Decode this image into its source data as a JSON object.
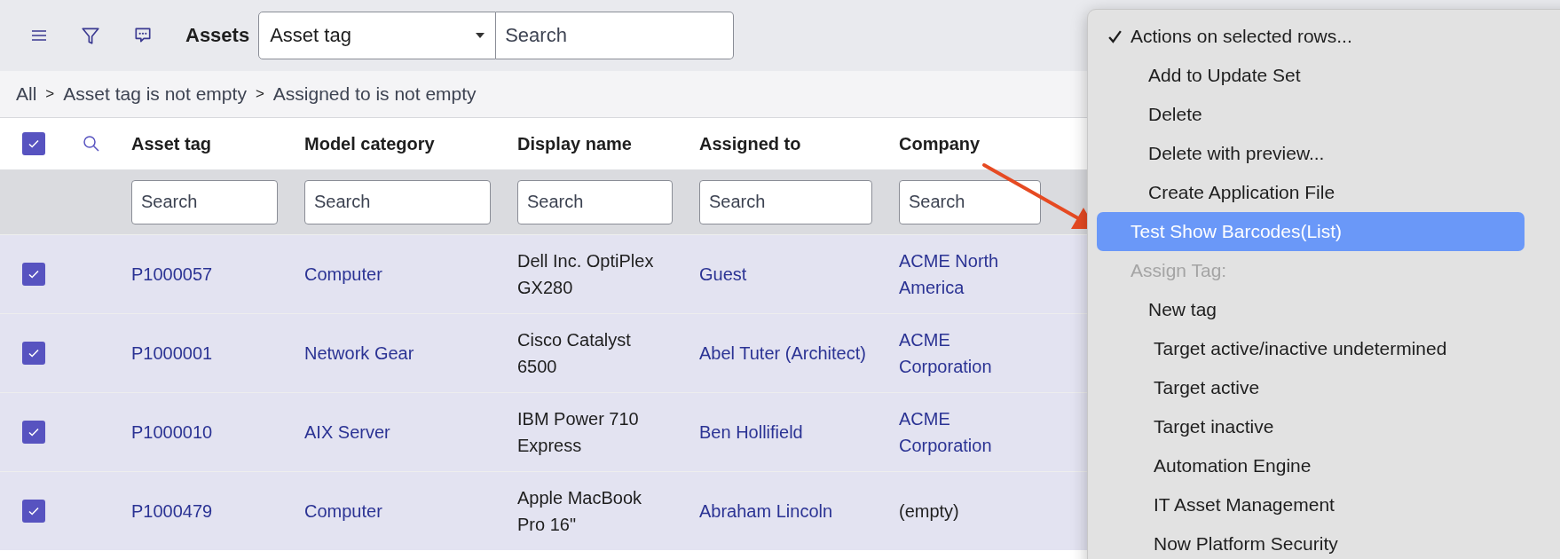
{
  "toolbar": {
    "title": "Assets",
    "field_select": "Asset tag",
    "search": {
      "placeholder": "Search"
    }
  },
  "breadcrumb": {
    "separator": ">",
    "items": [
      "All",
      "Asset tag is not empty",
      "Assigned to is not empty"
    ]
  },
  "table": {
    "select_all": {
      "checked": true
    },
    "columns": [
      {
        "label": "Asset tag",
        "placeholder": "Search"
      },
      {
        "label": "Model category",
        "placeholder": "Search"
      },
      {
        "label": "Display name",
        "placeholder": "Search"
      },
      {
        "label": "Assigned to",
        "placeholder": "Search"
      },
      {
        "label": "Company",
        "placeholder": "Search"
      }
    ],
    "rows": [
      {
        "selected": true,
        "asset_tag": "P1000057",
        "model_category": "Computer",
        "display_name": "Dell Inc. OptiPlex GX280",
        "assigned_to": "Guest",
        "company": {
          "text": "ACME North America",
          "kind": "link"
        }
      },
      {
        "selected": true,
        "asset_tag": "P1000001",
        "model_category": "Network Gear",
        "display_name": "Cisco Catalyst 6500",
        "assigned_to": "Abel Tuter (Architect)",
        "company": {
          "text": "ACME Corporation",
          "kind": "link"
        }
      },
      {
        "selected": true,
        "asset_tag": "P1000010",
        "model_category": "AIX Server",
        "display_name": "IBM Power 710 Express",
        "assigned_to": "Ben Hollifield",
        "company": {
          "text": "ACME Corporation",
          "kind": "link"
        }
      },
      {
        "selected": true,
        "asset_tag": "P1000479",
        "model_category": "Computer",
        "display_name": "Apple MacBook Pro 16\"",
        "assigned_to": "Abraham Lincoln",
        "company": {
          "text": "(empty)",
          "kind": "empty"
        }
      }
    ]
  },
  "menu": {
    "items": [
      {
        "label": "Actions on selected rows...",
        "checked": true,
        "selected": false,
        "disabled": false,
        "children": [
          {
            "label": "Add to Update Set",
            "selected": false,
            "disabled": false
          },
          {
            "label": "Delete",
            "selected": false,
            "disabled": false
          },
          {
            "label": "Delete with preview...",
            "selected": false,
            "disabled": false
          },
          {
            "label": "Create Application File",
            "selected": false,
            "disabled": false
          }
        ]
      },
      {
        "label": "Test Show Barcodes(List)",
        "checked": false,
        "selected": true,
        "disabled": false
      },
      {
        "label": "Assign Tag:",
        "checked": false,
        "selected": false,
        "disabled": true,
        "children": [
          {
            "label": "New tag",
            "selected": false,
            "disabled": false,
            "children": [
              {
                "label": "Target active/inactive undetermined",
                "selected": false,
                "disabled": false
              },
              {
                "label": "Target active",
                "selected": false,
                "disabled": false
              },
              {
                "label": "Target inactive",
                "selected": false,
                "disabled": false
              },
              {
                "label": "Automation Engine",
                "selected": false,
                "disabled": false
              },
              {
                "label": "IT Asset Management",
                "selected": false,
                "disabled": false
              },
              {
                "label": "Now Platform Security",
                "selected": false,
                "disabled": false
              }
            ]
          }
        ]
      }
    ]
  }
}
